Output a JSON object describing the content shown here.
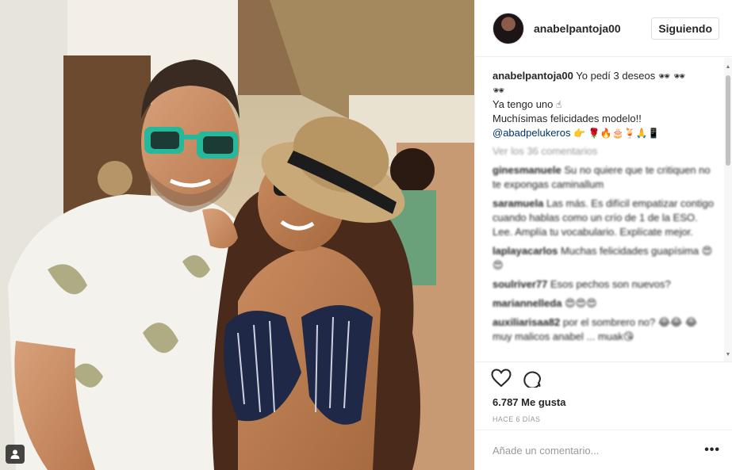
{
  "post": {
    "username": "anabelpantoja00",
    "follow_label": "Siguiendo",
    "caption": {
      "username": "anabelpantoja00",
      "line1": "Yo pedí 3 deseos",
      "line1_emoji": "🕶 🕶",
      "line2_emoji": "🕶",
      "line3": "Ya tengo uno",
      "line3_emoji": "☝",
      "line4": "Muchísimas felicidades modelo!!",
      "mention": "@abadpelukeros",
      "mention_emoji": "👉 🌹🔥🎂🍹🙏📱"
    },
    "view_all_comments": "Ver los 36 comentarios",
    "comments": [
      {
        "user": "ginesmanuele",
        "text": "Su no quiere que te critiquen no te expongas caminallum"
      },
      {
        "user": "saramuela",
        "text": "Las más. Es difícil empatizar contigo cuando hablas como un crío de 1 de la ESO. Lee. Amplía tu vocabulario. Explícate mejor."
      },
      {
        "user": "laplayacarlos",
        "text": "Muchas felicidades guapísima 😍😍"
      },
      {
        "user": "soulriver77",
        "text": "Esos pechos son nuevos?"
      },
      {
        "user": "mariannelleda",
        "text": "😍😍😍"
      },
      {
        "user": "auxiliarisaa82",
        "text": "por el sombrero no? 😂😂 😂 muy malicos anabel ... muak😘"
      }
    ],
    "likes": "6.787 Me gusta",
    "date": "HACE 6 DÍAS",
    "comment_placeholder": "Añade un comentario...",
    "more_label": "•••"
  },
  "icons": {
    "like": "heart-outline-icon",
    "comment": "speech-bubble-icon",
    "tag": "user-tag-icon",
    "more": "ellipsis-icon"
  },
  "colors": {
    "mention": "#003569",
    "muted": "#999999",
    "text": "#262626",
    "border": "#efefef"
  }
}
